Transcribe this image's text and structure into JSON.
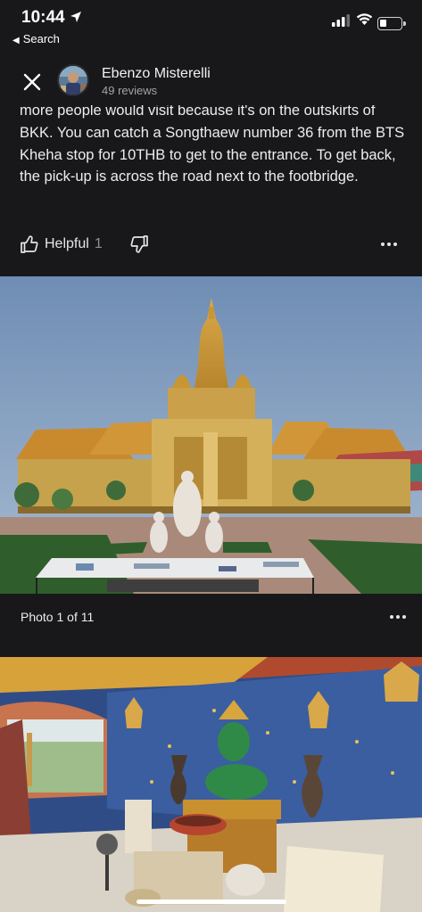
{
  "status_bar": {
    "time": "10:44",
    "back_app_label": "Search"
  },
  "reviewer": {
    "name": "Ebenzo Misterelli",
    "review_count": "49 reviews"
  },
  "review": {
    "text": "more people would visit because it's on the outskirts of BKK. You can catch a Songthaew number 36 from the BTS Kheha stop for 10THB to get to the entrance. To get back, the pick-up is across the road next to the footbridge."
  },
  "actions": {
    "helpful_label": "Helpful",
    "helpful_count": "1"
  },
  "photos": {
    "caption": "Photo 1 of 11"
  },
  "colors": {
    "background": "#18181b",
    "text": "#ededf0",
    "secondary_text": "#a3a3a8"
  }
}
